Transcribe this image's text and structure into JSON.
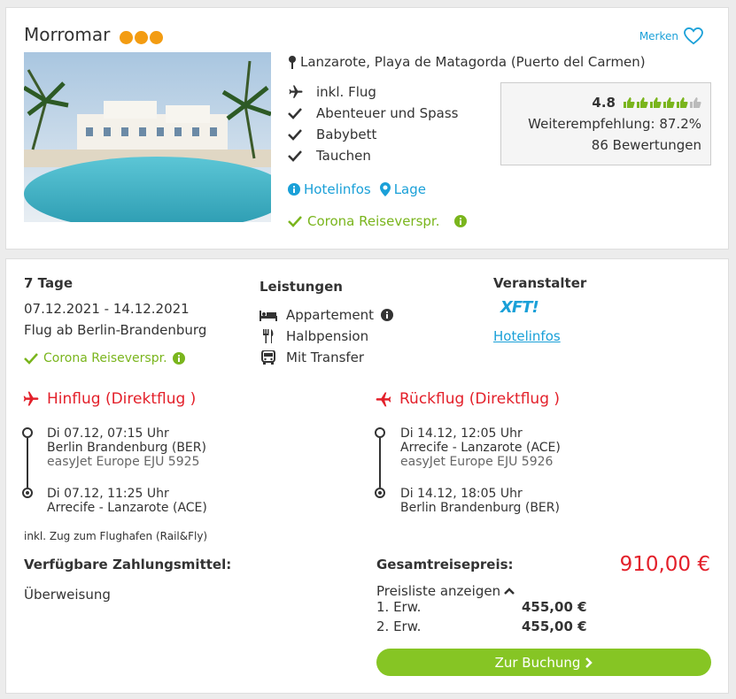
{
  "hotel": {
    "name": "Morromar",
    "merken_label": "Merken",
    "location": "Lanzarote, Playa de Matagorda (Puerto del Carmen)",
    "features": [
      "inkl. Flug",
      "Abenteuer und Spass",
      "Babybett",
      "Tauchen"
    ],
    "rating": {
      "score": "4.8",
      "recommendation": "Weiterempfehlung: 87.2%",
      "reviews": "86 Bewertungen"
    },
    "links": {
      "hotelinfos": "Hotelinfos",
      "lage": "Lage"
    },
    "corona": "Corona Reiseverspr."
  },
  "offer": {
    "duration": "7 Tage",
    "dates": "07.12.2021 - 14.12.2021",
    "departure": "Flug ab Berlin-Brandenburg",
    "corona": "Corona Reiseverspr.",
    "leistungen_title": "Leistungen",
    "leistungen": [
      "Appartement",
      "Halbpension",
      "Mit Transfer"
    ],
    "veranstalter_title": "Veranstalter",
    "veranstalter_logo": "XFT!",
    "veranstalter_link": "Hotelinfos"
  },
  "outbound": {
    "title": "Hinflug (Direktflug )",
    "dep_time": "Di 07.12, 07:15 Uhr",
    "dep_airport": "Berlin Brandenburg (BER)",
    "airline": "easyJet Europe EJU 5925",
    "arr_time": "Di 07.12, 11:25 Uhr",
    "arr_airport": "Arrecife - Lanzarote (ACE)"
  },
  "return": {
    "title": "Rückflug (Direktflug )",
    "dep_time": "Di 14.12, 12:05 Uhr",
    "dep_airport": "Arrecife - Lanzarote (ACE)",
    "airline": "easyJet Europe EJU 5926",
    "arr_time": "Di 14.12, 18:05 Uhr",
    "arr_airport": "Berlin Brandenburg (BER)"
  },
  "rail_note": "inkl. Zug zum Flughafen (Rail&Fly)",
  "payment": {
    "title": "Verfügbare Zahlungsmittel:",
    "method": "Überweisung"
  },
  "price": {
    "label": "Gesamtreisepreis:",
    "total": "910,00 €",
    "list_toggle": "Preisliste anzeigen",
    "rows": [
      {
        "label": "1. Erw.",
        "value": "455,00 €"
      },
      {
        "label": "2. Erw.",
        "value": "455,00 €"
      }
    ],
    "button": "Zur Buchung"
  },
  "colors": {
    "accent": "#1aa0d8",
    "green": "#7ab51d",
    "red": "#e3202a",
    "stars": "#f39c12",
    "button": "#86c524"
  }
}
